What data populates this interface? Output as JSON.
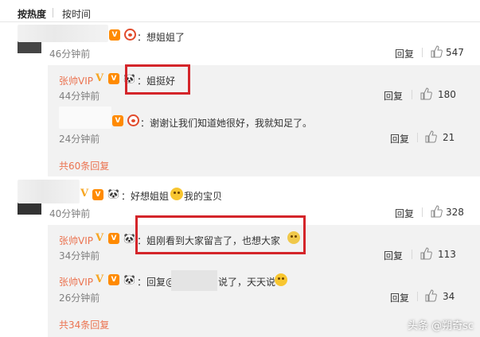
{
  "sort": {
    "hot": "按热度",
    "time": "按时间"
  },
  "comments": [
    {
      "text": "：想姐姐了",
      "time": "46分钟前",
      "reply": "回复",
      "likes": "547"
    },
    {
      "user": "张帅VIP",
      "text": "：姐挺好",
      "time": "44分钟前",
      "reply": "回复",
      "likes": "180"
    },
    {
      "text": "：谢谢让我们知道她很好，我就知足了。",
      "time": "24分钟前",
      "reply": "回复",
      "likes": "21"
    },
    {
      "more": "共60条回复"
    },
    {
      "text_a": "：好想姐姐",
      "text_b": "我的宝贝",
      "time": "40分钟前",
      "reply": "回复",
      "likes": "328"
    },
    {
      "user": "张帅VIP",
      "text": "：姐刚看到大家留言了，也想大家",
      "time": "34分钟前",
      "reply": "回复",
      "likes": "113"
    },
    {
      "user": "张帅VIP",
      "text_a": "：回复@",
      "text_b": "说了，天天说",
      "time": "26分钟前",
      "reply": "回复",
      "likes": "34"
    },
    {
      "more": "共34条回复"
    }
  ],
  "watermark": "头条 @朔奇sc",
  "colors": {
    "username": "#eb7350",
    "highlight": "#d4252a",
    "reply_bg": "#f2f2f2"
  }
}
